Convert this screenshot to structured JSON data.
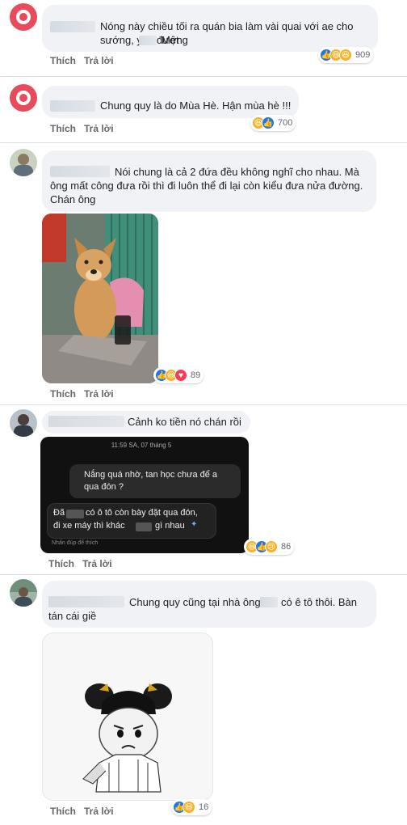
{
  "actions": {
    "like": "Thích",
    "reply": "Trả lời"
  },
  "comments": [
    {
      "text": "Nóng này chiều tối ra quán bia làm vài quai với ae cho sướng, yêu đương",
      "text_tail": "Mệt",
      "reaction_count": "909",
      "reactions": [
        "like",
        "haha",
        "haha"
      ]
    },
    {
      "text": "Chung quy là do Mùa Hè. Hận mùa hè !!!",
      "reaction_count": "700",
      "reactions": [
        "haha",
        "like"
      ]
    },
    {
      "text": "Nói chung là cả 2 đứa đều không nghĩ cho nhau. Mà ông mất công đưa rồi thì đi luôn thể đi lại còn kiểu đưa nửa đường. Chán ông",
      "reaction_count": "89",
      "reactions": [
        "like",
        "haha",
        "love"
      ]
    },
    {
      "text": "Cảnh ko tiền nó chán rồi",
      "reaction_count": "86",
      "reactions": [
        "haha",
        "like",
        "sad"
      ],
      "chat_screenshot": {
        "time": "11:59 SA, 07 tháng 5",
        "sent": "Nắng quá nhờ, tan học chưa để a qua đón ?",
        "received_a": "Đã",
        "received_b": "có ô tô còn bày đặt qua đón,",
        "received_c": "đi xe máy thì khác",
        "received_d": "gì nhau",
        "hint": "Nhấn đúp để thích"
      }
    },
    {
      "text": "Chung quy cũng tại nhà ông",
      "text_tail": "có ê tô thôi. Bàn tán cái giề",
      "reaction_count": "16",
      "reactions": [
        "like",
        "haha"
      ]
    }
  ],
  "colors": {
    "bubble": "#f0f2f5",
    "like": "#1877f2",
    "haha": "#f7b125",
    "love": "#f33e58",
    "chat_bg": "#111111"
  }
}
